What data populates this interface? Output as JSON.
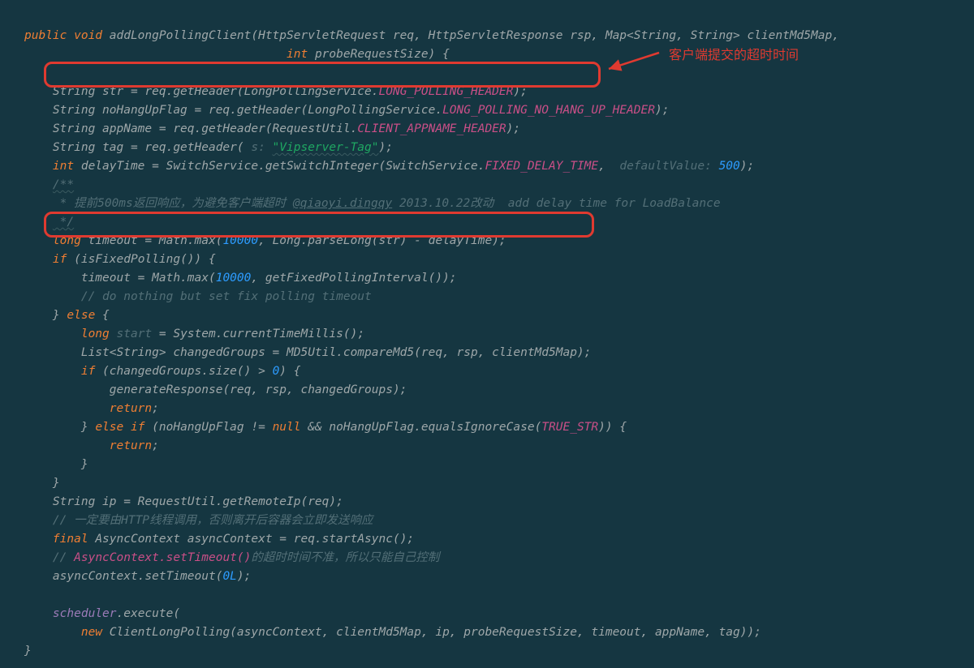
{
  "code": {
    "l1_public": "public ",
    "l1_void": "void ",
    "l1_method": "addLongPollingClient(HttpServletRequest req, HttpServletResponse rsp, Map<String, String> clientMd5Map,",
    "l2_int": "int ",
    "l2_rest": "probeRequestSize) {",
    "l4_a": "String str = req.getHeader(LongPollingService.",
    "l4_const": "LONG_POLLING_HEADER",
    "l4_c": ");",
    "l5_a": "String noHangUpFlag = req.getHeader(LongPollingService.",
    "l5_const": "LONG_POLLING_NO_HANG_UP_HEADER",
    "l5_c": ");",
    "l6_a": "String appName = req.getHeader(RequestUtil.",
    "l6_const": "CLIENT_APPNAME_HEADER",
    "l6_c": ");",
    "l7_a": "String tag = req.getHeader(",
    "l7_hint": " s: ",
    "l7_str": "\"Vipserver-Tag\"",
    "l7_c": ");",
    "l8_int": "int ",
    "l8_a": "delayTime = SwitchService.getSwitchInteger(SwitchService.",
    "l8_const": "FIXED_DELAY_TIME",
    "l8_b": ", ",
    "l8_hint": " defaultValue: ",
    "l8_num": "500",
    "l8_c": ");",
    "l9": "/**",
    "l10a": " * 提前500ms返回响应，为避免客户端超时 ",
    "l10b": "@qiaoyi.dingqy",
    "l10c": " 2013.10.22改动  add delay time for LoadBalance",
    "l11": " */",
    "l12_kw": "long ",
    "l12_a": "timeout = Math.max(",
    "l12_n1": "10000",
    "l12_b": ", Long.parseLong(str) - delayTime);",
    "l13_kw": "if ",
    "l13_a": "(isFixedPolling()) {",
    "l14_a": "timeout = Math.max(",
    "l14_n": "10000",
    "l14_b": ", getFixedPollingInterval());",
    "l15": "// do nothing but set fix polling timeout",
    "l16_a": "} ",
    "l16_kw": "else ",
    "l16_b": "{",
    "l17_kw": "long ",
    "l17_var": "start",
    "l17_b": " = System.currentTimeMillis();",
    "l18_a": "List<String> changedGroups = MD5Util.compareMd5(req, rsp, clientMd5Map);",
    "l19_kw": "if ",
    "l19_a": "(changedGroups.size() > ",
    "l19_n": "0",
    "l19_b": ") {",
    "l20": "generateResponse(req, rsp, changedGroups);",
    "l21_kw": "return",
    "l21_b": ";",
    "l22_a": "} ",
    "l22_kw1": "else if ",
    "l22_b": "(noHangUpFlag != ",
    "l22_null": "null",
    "l22_c": " && noHangUpFlag.equalsIgnoreCase(",
    "l22_const": "TRUE_STR",
    "l22_d": ")) {",
    "l23_kw": "return",
    "l23_b": ";",
    "l24": "}",
    "l25": "}",
    "l26": "String ip = RequestUtil.getRemoteIp(req);",
    "l27": "// 一定要由HTTP线程调用，否则离开后容器会立即发送响应",
    "l28_kw": "final ",
    "l28_a": "AsyncContext asyncContext = req.startAsync();",
    "l29a": "// ",
    "l29b": "AsyncContext.setTimeout()",
    "l29c": "的超时时间不准，所以只能自己控制",
    "l30_a": "asyncContext.setTimeout(",
    "l30_n": "0L",
    "l30_b": ");",
    "l32_field": "scheduler",
    "l32_a": ".execute(",
    "l33_kw": "new ",
    "l33_a": "ClientLongPolling(asyncContext, clientMd5Map, ip, probeRequestSize, timeout, appName, tag));",
    "l34": "}"
  },
  "annotation": "客户端提交的超时时间"
}
